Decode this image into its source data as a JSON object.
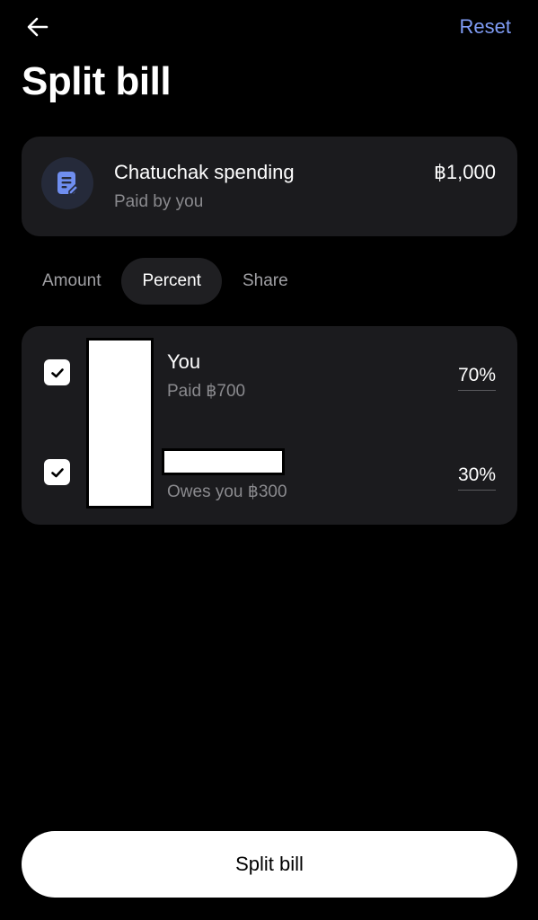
{
  "header": {
    "back_icon": "arrow-left-icon",
    "reset_label": "Reset",
    "title": "Split bill"
  },
  "bill": {
    "icon": "receipt-icon",
    "name": "Chatuchak spending",
    "paid_by": "Paid by you",
    "amount": "฿1,000"
  },
  "tabs": [
    {
      "label": "Amount",
      "active": false
    },
    {
      "label": "Percent",
      "active": true
    },
    {
      "label": "Share",
      "active": false
    }
  ],
  "participants": [
    {
      "name": "You",
      "status": "Paid ฿700",
      "percent": "70%",
      "checked": true
    },
    {
      "name": "",
      "status": "Owes you ฿300",
      "percent": "30%",
      "checked": true
    }
  ],
  "footer": {
    "split_label": "Split bill"
  },
  "colors": {
    "accent": "#7f9cf5",
    "background": "#000000",
    "card": "#1b1b1e",
    "icon_bg": "#252a3a"
  }
}
